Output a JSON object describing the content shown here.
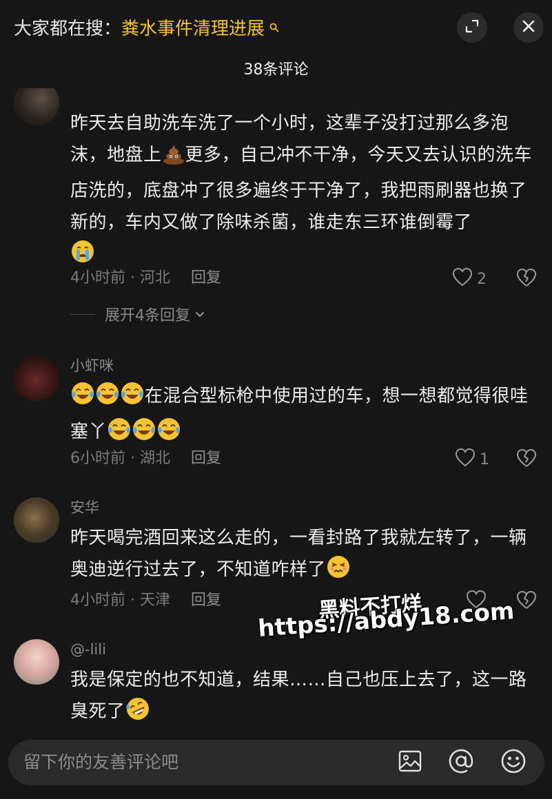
{
  "header": {
    "search_prefix": "大家都在搜：",
    "search_term": "粪水事件清理进展",
    "comment_count_title": "38条评论"
  },
  "icons": {
    "expand": "expand-icon",
    "close": "close-icon",
    "heart": "heart-icon",
    "broken_heart": "dislike-icon",
    "image": "image-icon",
    "at": "at-icon",
    "emoji": "emoji-icon"
  },
  "comments": [
    {
      "text_parts": [
        "昨天去自助洗车洗了一个小时，这辈子没打过那么多泡沫，地盘上",
        "更多，自己冲不干净，今天又去认识的洗车店洗的，底盘冲了很多遍终于干净了，我把雨刷器也换了新的，车内又做了除味杀菌，谁走东三环谁倒霉了"
      ],
      "time_location": "4小时前 · 河北",
      "reply": "回复",
      "likes": "2",
      "expand_replies": "展开4条回复"
    },
    {
      "username": "小虾咪",
      "text_a": "在混合型标枪中使用过的车，想一想都觉得很哇塞丫",
      "time_location": "6小时前 · 湖北",
      "reply": "回复",
      "likes": "1"
    },
    {
      "username": "安华",
      "text": "昨天喝完酒回来这么走的，一看封路了我就左转了，一辆奥迪逆行过去了，不知道咋样了",
      "time_location": "4小时前 · 天津",
      "reply": "回复"
    },
    {
      "username": "@-lili",
      "text": "我是保定的也不知道，结果……自己也压上去了，这一路臭死了"
    }
  ],
  "watermark": {
    "line1": "黑料不打烊",
    "line2": "https://abdy18.com"
  },
  "composer": {
    "placeholder": "留下你的友善评论吧"
  },
  "colors": {
    "background": "#161616",
    "accent": "#f5c518",
    "muted": "#7c7c7c"
  }
}
